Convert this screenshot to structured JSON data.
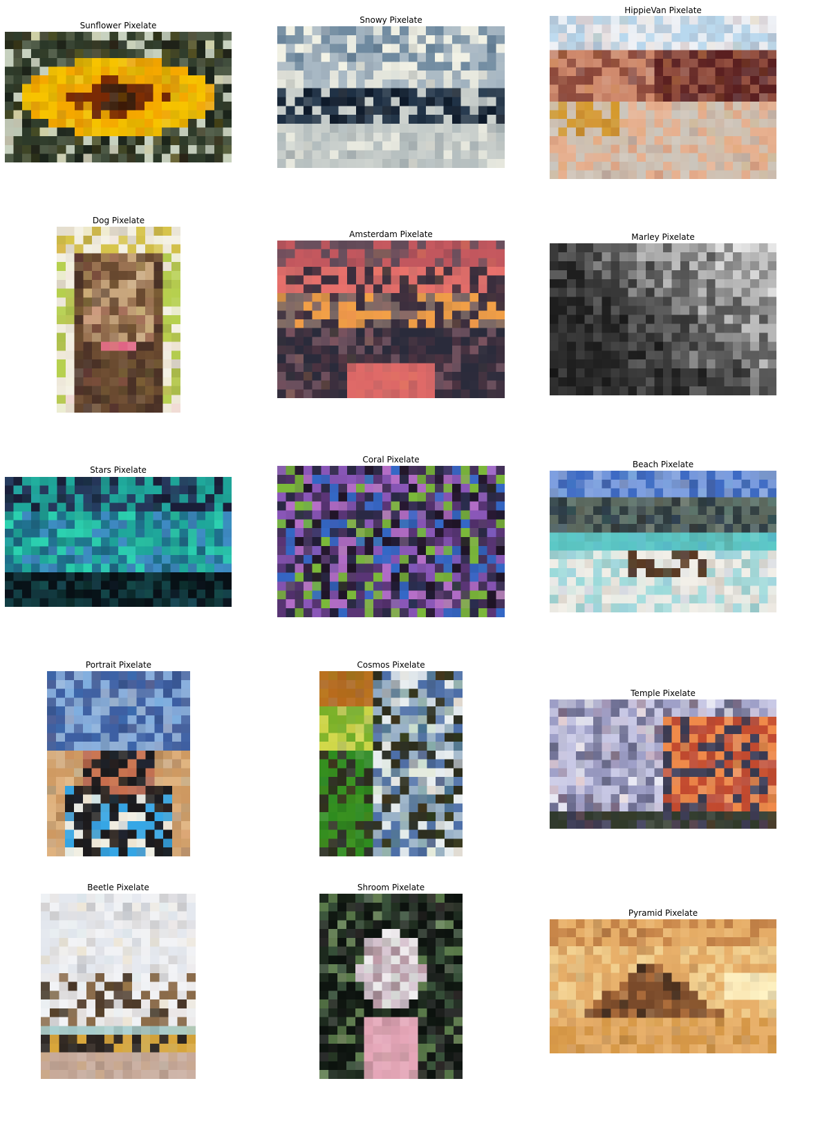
{
  "panels": [
    {
      "key": "sunflower",
      "title": "Sunflower Pixelate",
      "image": "pixelated sunflower photo",
      "palette": [
        "#2e3b2a",
        "#4e5a46",
        "#1b241b",
        "#f7c300",
        "#f5a800",
        "#7a2a05",
        "#3d1a07",
        "#c8d2c0"
      ]
    },
    {
      "key": "snowy",
      "title": "Snowy Pixelate",
      "image": "pixelated snowy mountain photo",
      "palette": [
        "#6f8aa0",
        "#a8b8c4",
        "#f3f3e6",
        "#e8e9df",
        "#203246",
        "#0e1a2a",
        "#c9cfcc",
        "#b7c0c0"
      ]
    },
    {
      "key": "hippievan",
      "title": "HippieVan Pixelate",
      "image": "pixelated hippie van desert photo",
      "palette": [
        "#b8d8ee",
        "#eef1f6",
        "#5a1f20",
        "#8e4a3c",
        "#d08a6d",
        "#e7b08f",
        "#d59a2f",
        "#cfc3b5"
      ]
    },
    {
      "key": "dog",
      "title": "Dog Pixelate",
      "image": "pixelated dog portrait photo",
      "palette": [
        "#6a4a30",
        "#9a7352",
        "#c9a77e",
        "#f4f1e4",
        "#d7c54b",
        "#b6d04f",
        "#e16686",
        "#4a3126"
      ]
    },
    {
      "key": "amsterdam",
      "title": "Amsterdam Pixelate",
      "image": "pixelated amsterdam canal photo",
      "palette": [
        "#3a2e3d",
        "#6a4f5d",
        "#e8716c",
        "#c2575e",
        "#f2a047",
        "#2a2b3b",
        "#7d6a66",
        "#df6a68"
      ]
    },
    {
      "key": "marley",
      "title": "Marley Pixelate",
      "image": "pixelated black and white portrait",
      "palette": [
        "#050505",
        "#1e1e1e",
        "#3a3a3a",
        "#5c5c5c",
        "#8d8d8d",
        "#bdbdbd",
        "#e6e6e6",
        "#2a2a2a"
      ]
    },
    {
      "key": "stars",
      "title": "Stars Pixelate",
      "image": "pixelated aurora night sky photo",
      "palette": [
        "#1a1d38",
        "#26385c",
        "#1fa89b",
        "#2cd1b0",
        "#1e6f8a",
        "#3f8cc4",
        "#071015",
        "#123a3e"
      ]
    },
    {
      "key": "coral",
      "title": "Coral Pixelate",
      "image": "pixelated coral reef photo",
      "palette": [
        "#1f1426",
        "#5a3576",
        "#8a57b8",
        "#3468c6",
        "#7bb83a",
        "#b66fc8",
        "#2a2945",
        "#45315a"
      ]
    },
    {
      "key": "beach",
      "title": "Beach Pixelate",
      "image": "pixelated tropical beach photo",
      "palette": [
        "#3d6ac4",
        "#7e9fe0",
        "#2d3a3e",
        "#5c6a60",
        "#5cc9c7",
        "#a8dede",
        "#f2efe8",
        "#5a3820"
      ]
    },
    {
      "key": "portrait",
      "title": "Portrait Pixelate",
      "image": "pixelated desert portrait photo",
      "palette": [
        "#3d5fa3",
        "#8ab0de",
        "#e0b37f",
        "#cf9a62",
        "#1b1a1c",
        "#f2f0e4",
        "#36a7e6",
        "#c86e4d"
      ]
    },
    {
      "key": "cosmos",
      "title": "Cosmos Pixelate",
      "image": "pixelated cosmos flowers photo",
      "palette": [
        "#b86a1b",
        "#2c2d1d",
        "#7cb22a",
        "#2f8c1f",
        "#d2d84a",
        "#9ab2c8",
        "#4d6fa8",
        "#e8eef0"
      ]
    },
    {
      "key": "temple",
      "title": "Temple Pixelate",
      "image": "pixelated temple landscape photo",
      "palette": [
        "#c9c9e6",
        "#9fa0c8",
        "#6e6f92",
        "#3a3a52",
        "#c24a2f",
        "#f08a4a",
        "#e9e9f4",
        "#303a2a"
      ]
    },
    {
      "key": "beetle",
      "title": "Beetle Pixelate",
      "image": "pixelated beetle car photo",
      "palette": [
        "#f2f3f6",
        "#e4e8ef",
        "#4d3a2a",
        "#8a6b4a",
        "#a9d0d0",
        "#d9a73c",
        "#c8aa9a",
        "#2a2420"
      ]
    },
    {
      "key": "shroom",
      "title": "Shroom Pixelate",
      "image": "pixelated mushroom photo",
      "palette": [
        "#0c120e",
        "#1d2a1e",
        "#38513a",
        "#5a7a4a",
        "#d9c8d4",
        "#b89aa6",
        "#e6a6b8",
        "#f0eef0"
      ]
    },
    {
      "key": "pyramid",
      "title": "Pyramid Pixelate",
      "image": "pixelated pyramid sunset photo",
      "palette": [
        "#7a4a2a",
        "#c8864a",
        "#e8b06a",
        "#f2cf8e",
        "#3a2418",
        "#fff3c4",
        "#d89a48",
        "#a96a3a"
      ]
    }
  ]
}
